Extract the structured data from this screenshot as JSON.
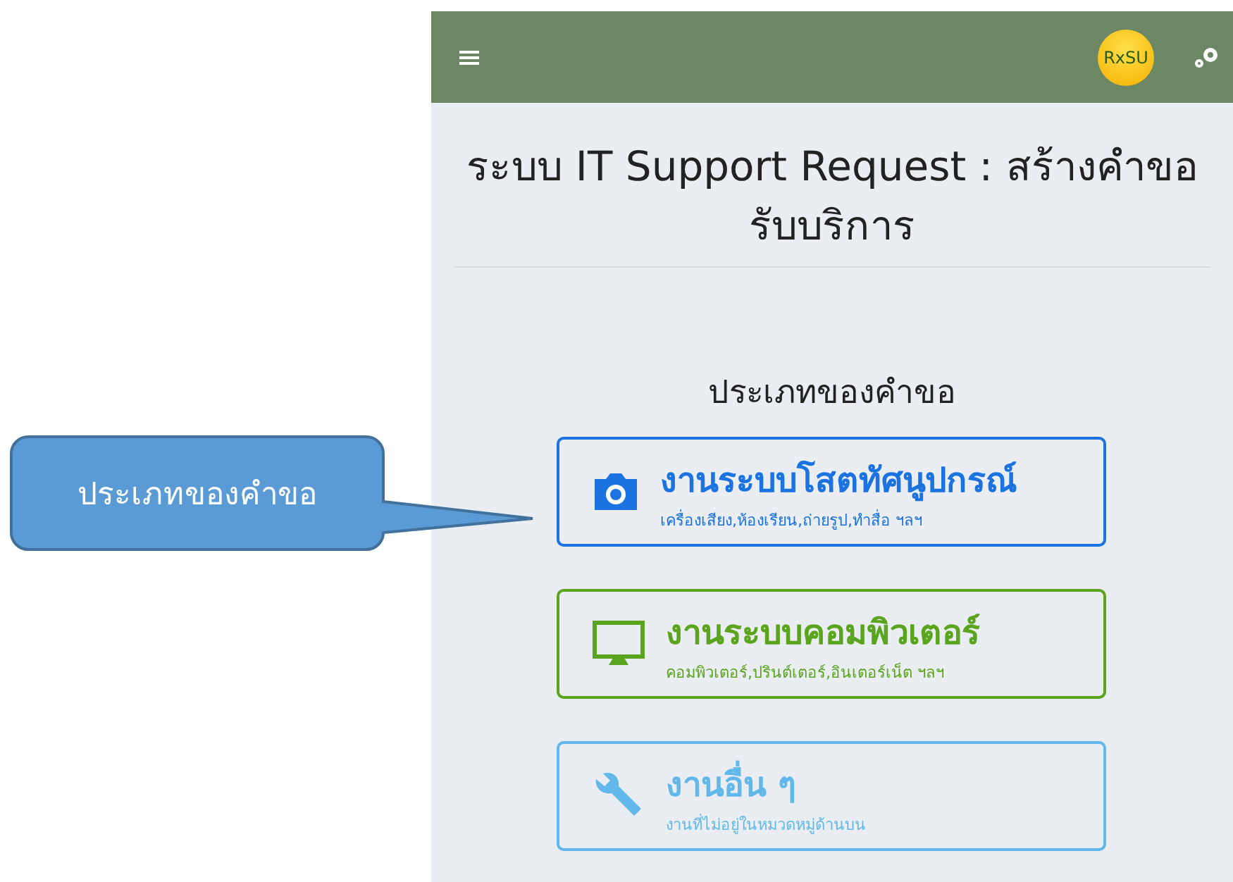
{
  "header": {
    "logo": "RxSU"
  },
  "page_title": "ระบบ IT Support Request : สร้างคำขอรับบริการ",
  "section_title": "ประเภทของคำขอ",
  "request_types": [
    {
      "kind": "camera",
      "color": "#1a73e0",
      "title": "งานระบบโสตทัศนูปกรณ์",
      "subtitle": "เครื่องเสียง,ห้องเรียน,ถ่ายรูป,ทำสื่อ ฯลฯ"
    },
    {
      "kind": "monitor",
      "color": "#5aa41e",
      "title": "งานระบบคอมพิวเตอร์",
      "subtitle": "คอมพิวเตอร์,ปรินต์เตอร์,อินเตอร์เน็ต ฯลฯ"
    },
    {
      "kind": "wrench",
      "color": "#62b8ea",
      "title": "งานอื่น ๆ",
      "subtitle": "งานที่ไม่อยู่ในหมวดหมู่ด้านบน"
    }
  ],
  "callout": {
    "text": "ประเภทของคำขอ"
  }
}
